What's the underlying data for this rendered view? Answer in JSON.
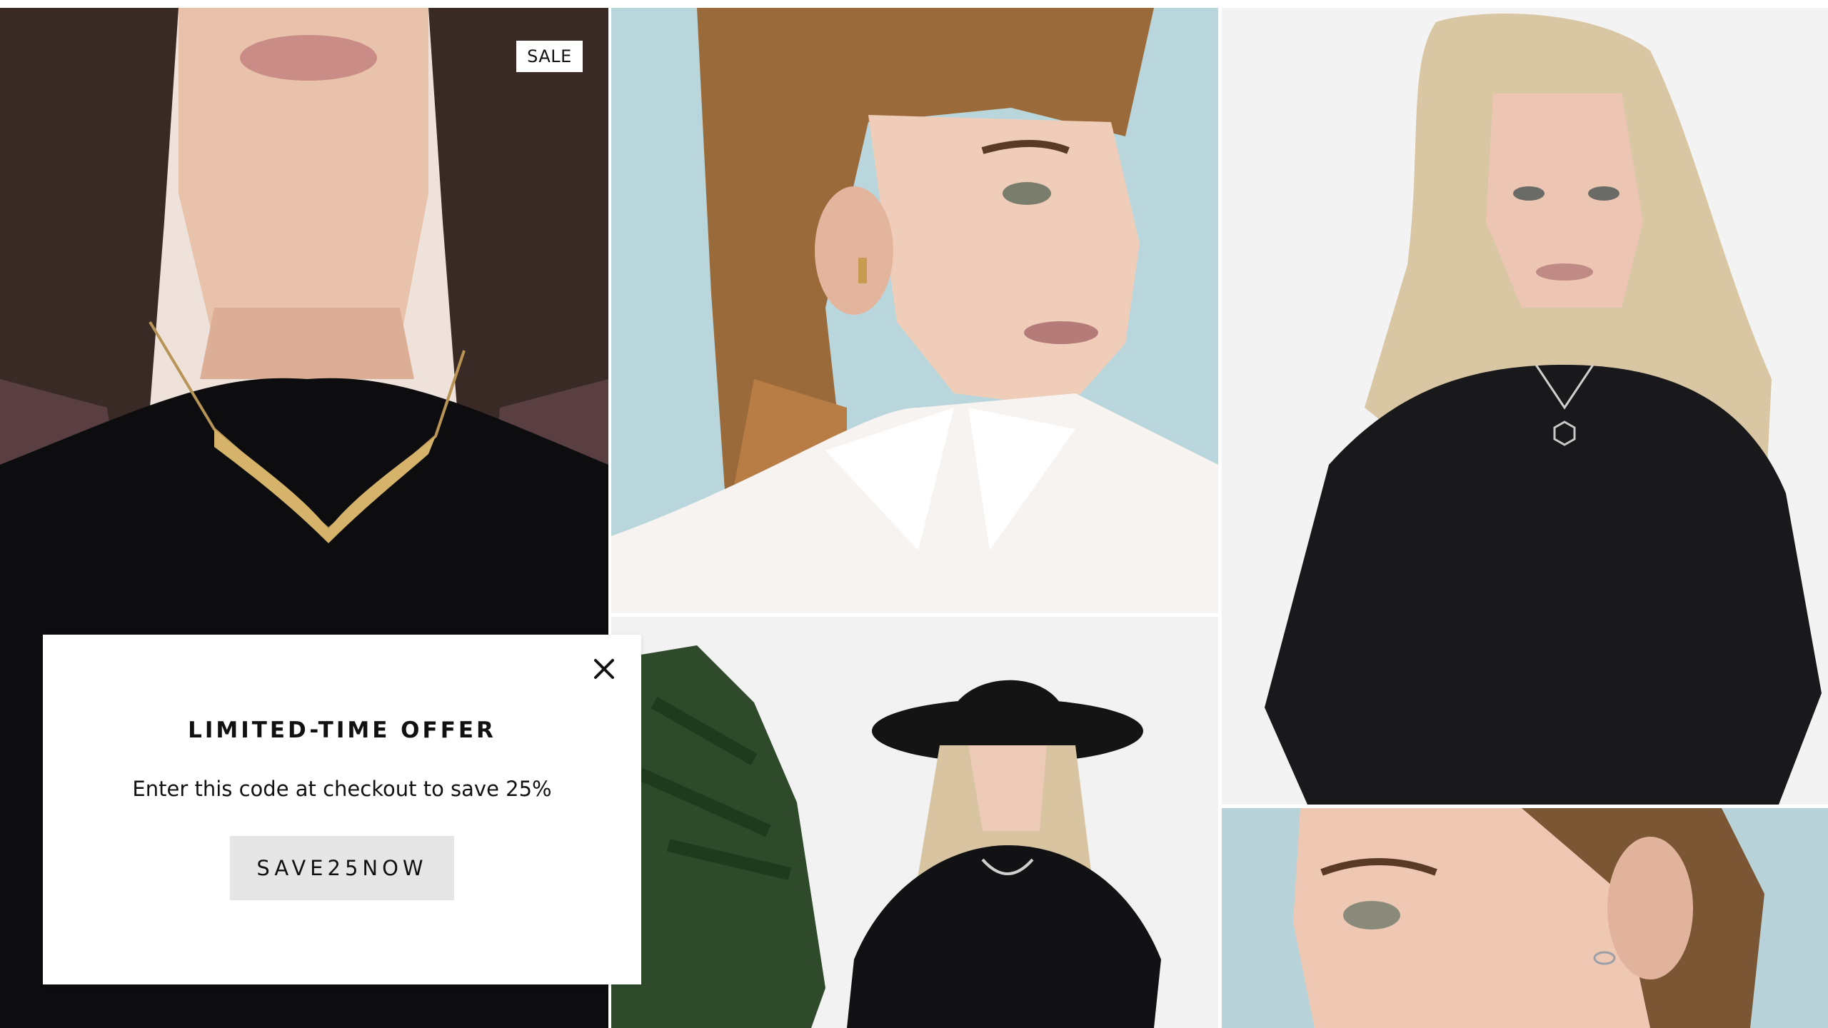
{
  "grid": {
    "tile_1": {
      "badge": "SALE",
      "alt": "woman-wearing-gold-necklace"
    },
    "tile_2": {
      "alt": "woman-wearing-stud-earring"
    },
    "tile_3": {
      "alt": "woman-wearing-hexagon-pendant"
    },
    "tile_4": {
      "alt": "woman-in-black-hat"
    },
    "tile_5": {
      "alt": "woman-wearing-orbit-earring"
    }
  },
  "popup": {
    "title": "LIMITED-TIME OFFER",
    "message": "Enter this code at checkout to save 25%",
    "code": "SAVE25NOW",
    "close_icon": "close-icon"
  },
  "colors": {
    "popup_bg": "#ffffff",
    "code_bg": "#e6e6e6",
    "text": "#111111"
  }
}
